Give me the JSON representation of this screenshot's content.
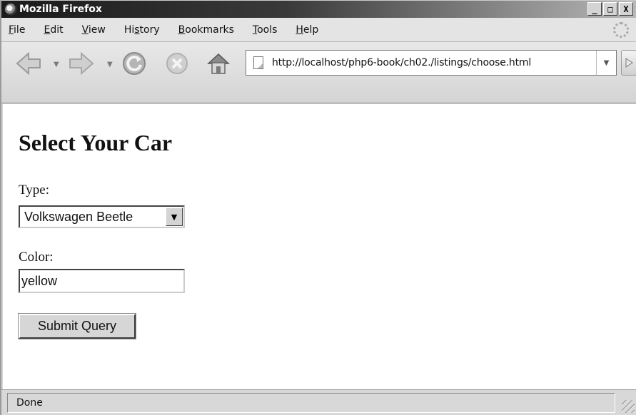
{
  "window": {
    "title": "Mozilla Firefox"
  },
  "window_buttons": {
    "minimize": "_",
    "maximize": "□",
    "close": "X"
  },
  "menu": [
    {
      "label": "File",
      "key": "F",
      "rest": "ile"
    },
    {
      "label": "Edit",
      "key": "E",
      "rest": "dit"
    },
    {
      "label": "View",
      "key": "V",
      "rest": "iew"
    },
    {
      "label": "History",
      "pre": "Hi",
      "key": "s",
      "rest": "tory"
    },
    {
      "label": "Bookmarks",
      "key": "B",
      "rest": "ookmarks"
    },
    {
      "label": "Tools",
      "key": "T",
      "rest": "ools"
    },
    {
      "label": "Help",
      "key": "H",
      "rest": "elp"
    }
  ],
  "toolbar": {
    "back_icon": "back-arrow-icon",
    "forward_icon": "forward-arrow-icon",
    "reload_icon": "reload-icon",
    "stop_icon": "stop-icon",
    "home_icon": "home-icon"
  },
  "address": {
    "url": "http://localhost/php6-book/ch02./listings/choose.html",
    "dropdown": "▼",
    "go": "▷"
  },
  "page": {
    "title": "Select Your Car",
    "type_label": "Type:",
    "type_value": "Volkswagen Beetle",
    "color_label": "Color:",
    "color_value": "yellow",
    "submit_label": "Submit Query"
  },
  "status": {
    "text": "Done"
  },
  "colors": {
    "titlebar_dark": "#1a1a1a",
    "titlebar_light": "#b8b8b8",
    "chrome": "#d6d6d6",
    "content_bg": "#ffffff"
  }
}
